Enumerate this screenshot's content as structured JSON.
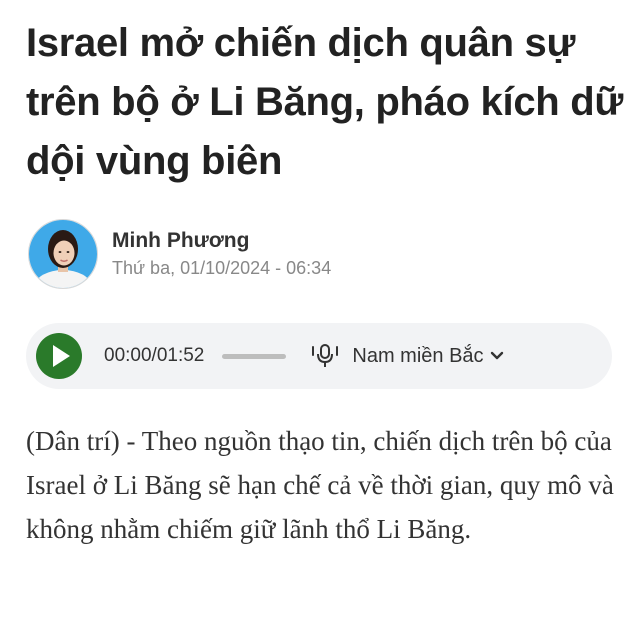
{
  "article": {
    "headline": "Israel mở chiến dịch quân sự trên bộ ở Li Băng, pháo kích dữ dội vùng biên",
    "sapo": "(Dân trí) - Theo nguồn thạo tin, chiến dịch trên bộ của Israel ở Li Băng sẽ hạn chế cả về thời gian, quy mô và không nhằm chiếm giữ lãnh thổ Li Băng."
  },
  "author": {
    "name": "Minh Phương",
    "published": "Thứ ba, 01/10/2024 - 06:34",
    "avatar_icon": "author-avatar-photo"
  },
  "audio_player": {
    "time": "00:00/01:52",
    "progress": 0,
    "voice_label": "Nam miền Bắc",
    "play_icon": "play-icon",
    "voice_icon": "microphone-icon",
    "dropdown_icon": "chevron-down-icon",
    "accent_color": "#2a7a2a",
    "background_color": "#f2f3f5"
  }
}
